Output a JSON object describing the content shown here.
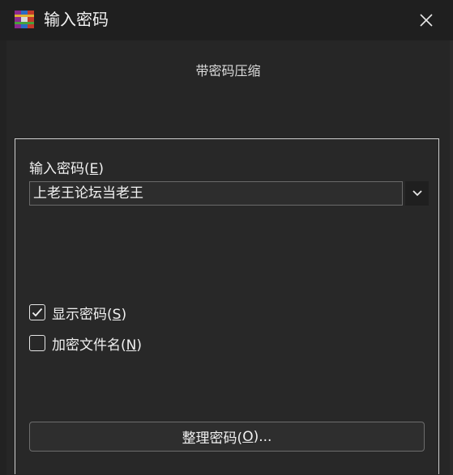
{
  "window": {
    "title": "输入密码",
    "close_label": "✕"
  },
  "dialog": {
    "heading": "带密码压缩",
    "password": {
      "label_prefix": "输入密码(",
      "label_key": "E",
      "label_suffix": ")",
      "value": "上老王论坛当老王"
    },
    "show_password": {
      "label_prefix": "显示密码(",
      "label_key": "S",
      "label_suffix": ")",
      "checked": true
    },
    "encrypt_filenames": {
      "label_prefix": "加密文件名(",
      "label_key": "N",
      "label_suffix": ")",
      "checked": false
    },
    "organize_button": {
      "label_prefix": "整理密码(",
      "label_key": "O",
      "label_suffix": ")..."
    }
  },
  "colors": {
    "title_bg": "#1f1f1f",
    "dialog_bg": "#262626",
    "text": "#f0f0f0"
  }
}
